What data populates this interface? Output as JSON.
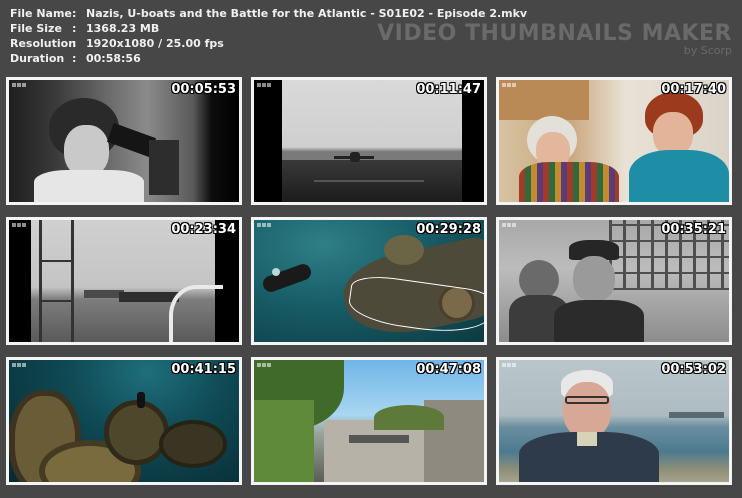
{
  "info": {
    "file_name_label": "File Name",
    "file_name": "Nazis, U-boats and the Battle for the Atlantic - S01E02 - Episode 2.mkv",
    "file_size_label": "File Size",
    "file_size": "1368.23 MB",
    "resolution_label": "Resolution",
    "resolution": "1920x1080 / 25.00 fps",
    "duration_label": "Duration",
    "duration": "00:58:56",
    "separator": ":"
  },
  "brand": {
    "title": "VIDEO THUMBNAILS MAKER",
    "subtitle": "by Scorp"
  },
  "thumbnails": [
    {
      "timecode": "00:05:53"
    },
    {
      "timecode": "00:11:47"
    },
    {
      "timecode": "00:17:40"
    },
    {
      "timecode": "00:23:34"
    },
    {
      "timecode": "00:29:28"
    },
    {
      "timecode": "00:35:21"
    },
    {
      "timecode": "00:41:15"
    },
    {
      "timecode": "00:47:08"
    },
    {
      "timecode": "00:53:02"
    }
  ]
}
